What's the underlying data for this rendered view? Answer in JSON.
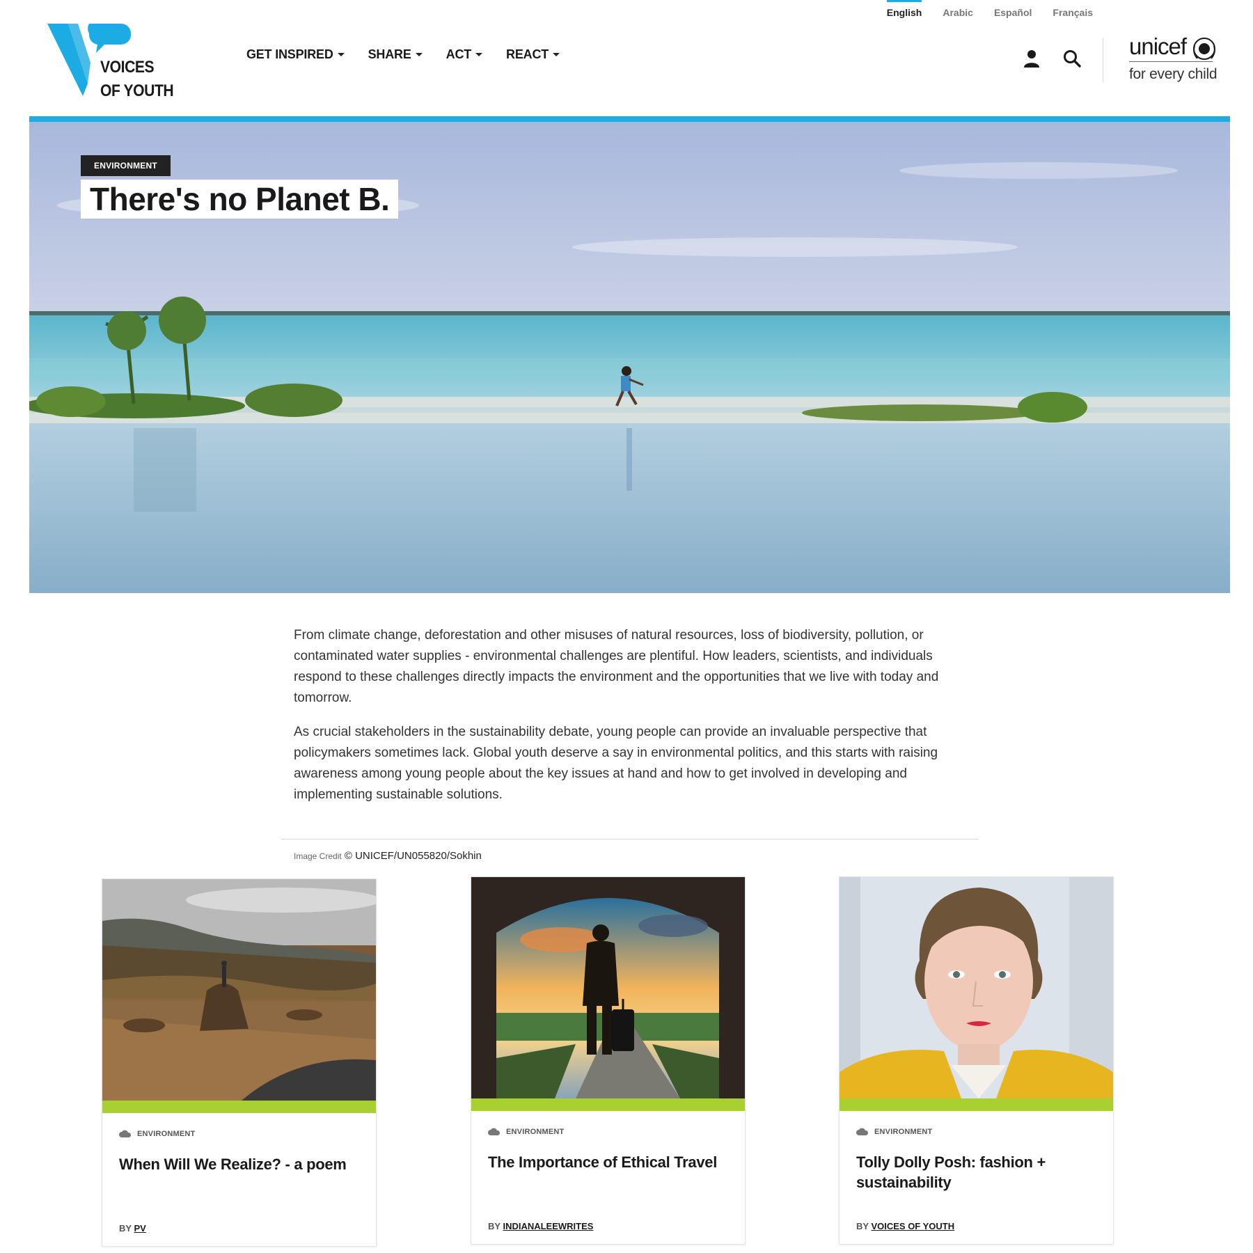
{
  "languages": [
    {
      "label": "English",
      "active": true
    },
    {
      "label": "Arabic"
    },
    {
      "label": "Español"
    },
    {
      "label": "Français"
    }
  ],
  "brand": {
    "line1": "VOICES",
    "line2": "OF YOUTH"
  },
  "nav": [
    {
      "label": "GET INSPIRED"
    },
    {
      "label": "SHARE"
    },
    {
      "label": "ACT"
    },
    {
      "label": "REACT"
    }
  ],
  "header_icons": [
    "user-icon",
    "search-icon"
  ],
  "unicef": {
    "word": "unicef",
    "tagline": "for every child"
  },
  "hero": {
    "category": "ENVIRONMENT",
    "title": "There's no Planet B."
  },
  "intro": {
    "paragraphs": [
      "From climate change, deforestation and other misuses of natural resources, loss of biodiversity, pollution, or contaminated water supplies - environmental challenges are plentiful. How leaders, scientists, and individuals respond to these challenges directly impacts the environment and the opportunities that we live with today and tomorrow.",
      "As crucial stakeholders in the sustainability debate, young people can provide an invaluable perspective that policymakers sometimes lack. Global youth deserve a say in environmental politics, and this starts with raising awareness among young people about the key issues at hand and how to get involved in developing and implementing sustainable solutions."
    ],
    "credit_label": "Image Credit",
    "credit_value": "© UNICEF/UN055820/Sokhin"
  },
  "cards": [
    {
      "category": "ENVIRONMENT",
      "title": "When Will We Realize? - a poem",
      "by": "BY",
      "author": "PV"
    },
    {
      "category": "ENVIRONMENT",
      "title": "The Importance of Ethical Travel",
      "by": "BY",
      "author": "INDIANALEEWRITES"
    },
    {
      "category": "ENVIRONMENT",
      "title": "Tolly Dolly Posh: fashion + sustainability",
      "by": "BY",
      "author": "VOICES OF YOUTH"
    }
  ],
  "colors": {
    "accent": "#1cabe2",
    "card_bar": "#a7d030",
    "badge_bg": "#222222"
  }
}
